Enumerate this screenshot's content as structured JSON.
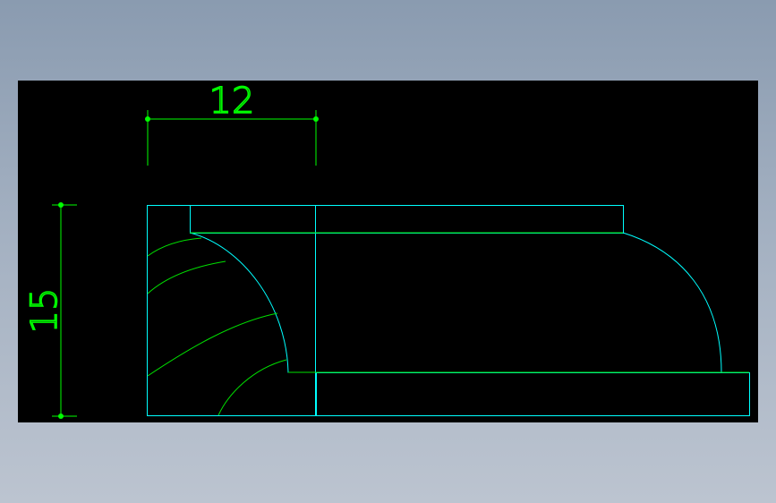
{
  "colors": {
    "background_gradient_top": "#8a9bb0",
    "background_gradient_bottom": "#bcc4d0",
    "viewport": "#000000",
    "dimension": "#00ff00",
    "outline": "#00ffff",
    "profile": "#00e000",
    "point": "#00ff00"
  },
  "dimensions": {
    "horizontal": {
      "value_label": "12"
    },
    "vertical": {
      "value_label": "15"
    }
  }
}
